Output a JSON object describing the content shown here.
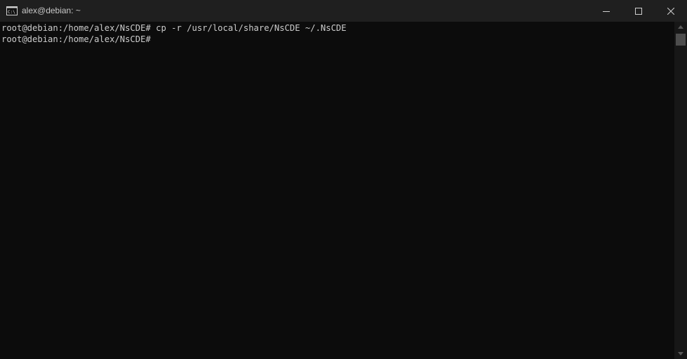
{
  "window": {
    "title": "alex@debian: ~",
    "icon": "console-icon"
  },
  "controls": {
    "minimize_icon": "minimize-icon",
    "maximize_icon": "maximize-icon",
    "close_icon": "close-icon"
  },
  "terminal": {
    "lines": [
      "root@debian:/home/alex/NsCDE# cp -r /usr/local/share/NsCDE ~/.NsCDE",
      "root@debian:/home/alex/NsCDE#"
    ]
  },
  "scrollbar": {
    "position": 0
  },
  "colors": {
    "background": "#0c0c0c",
    "titlebar": "#1f1f1f",
    "text": "#cccccc"
  }
}
